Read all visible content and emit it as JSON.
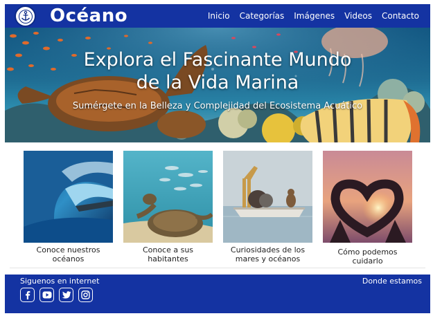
{
  "nav": {
    "brand": "Océano",
    "links": [
      "Inicio",
      "Categorías",
      "Imágenes",
      "Videos",
      "Contacto"
    ]
  },
  "hero": {
    "title_line1": "Explora el Fascinante Mundo",
    "title_line2": "de la Vida Marina",
    "subtitle": "Sumérgete en la Belleza y Complejidad del Ecosistema Acuático"
  },
  "cards": [
    {
      "line1": "Conoce nuestros",
      "line2": "océanos",
      "icon": "wave-image"
    },
    {
      "line1": "Conoce a sus",
      "line2": "habitantes",
      "icon": "turtle-image"
    },
    {
      "line1": "Curiosidades de los",
      "line2": "mares y océanos",
      "icon": "boat-animals-image"
    },
    {
      "line1": "Cómo podemos",
      "line2": "cuidarlo",
      "icon": "heart-hands-image"
    }
  ],
  "footer": {
    "follow_label": "Siguenos en internet",
    "where_label": "Donde estamos",
    "socials": [
      "facebook-icon",
      "youtube-icon",
      "twitter-icon",
      "instagram-icon"
    ]
  },
  "colors": {
    "primary": "#1433a2",
    "text_light": "#ffffff"
  }
}
